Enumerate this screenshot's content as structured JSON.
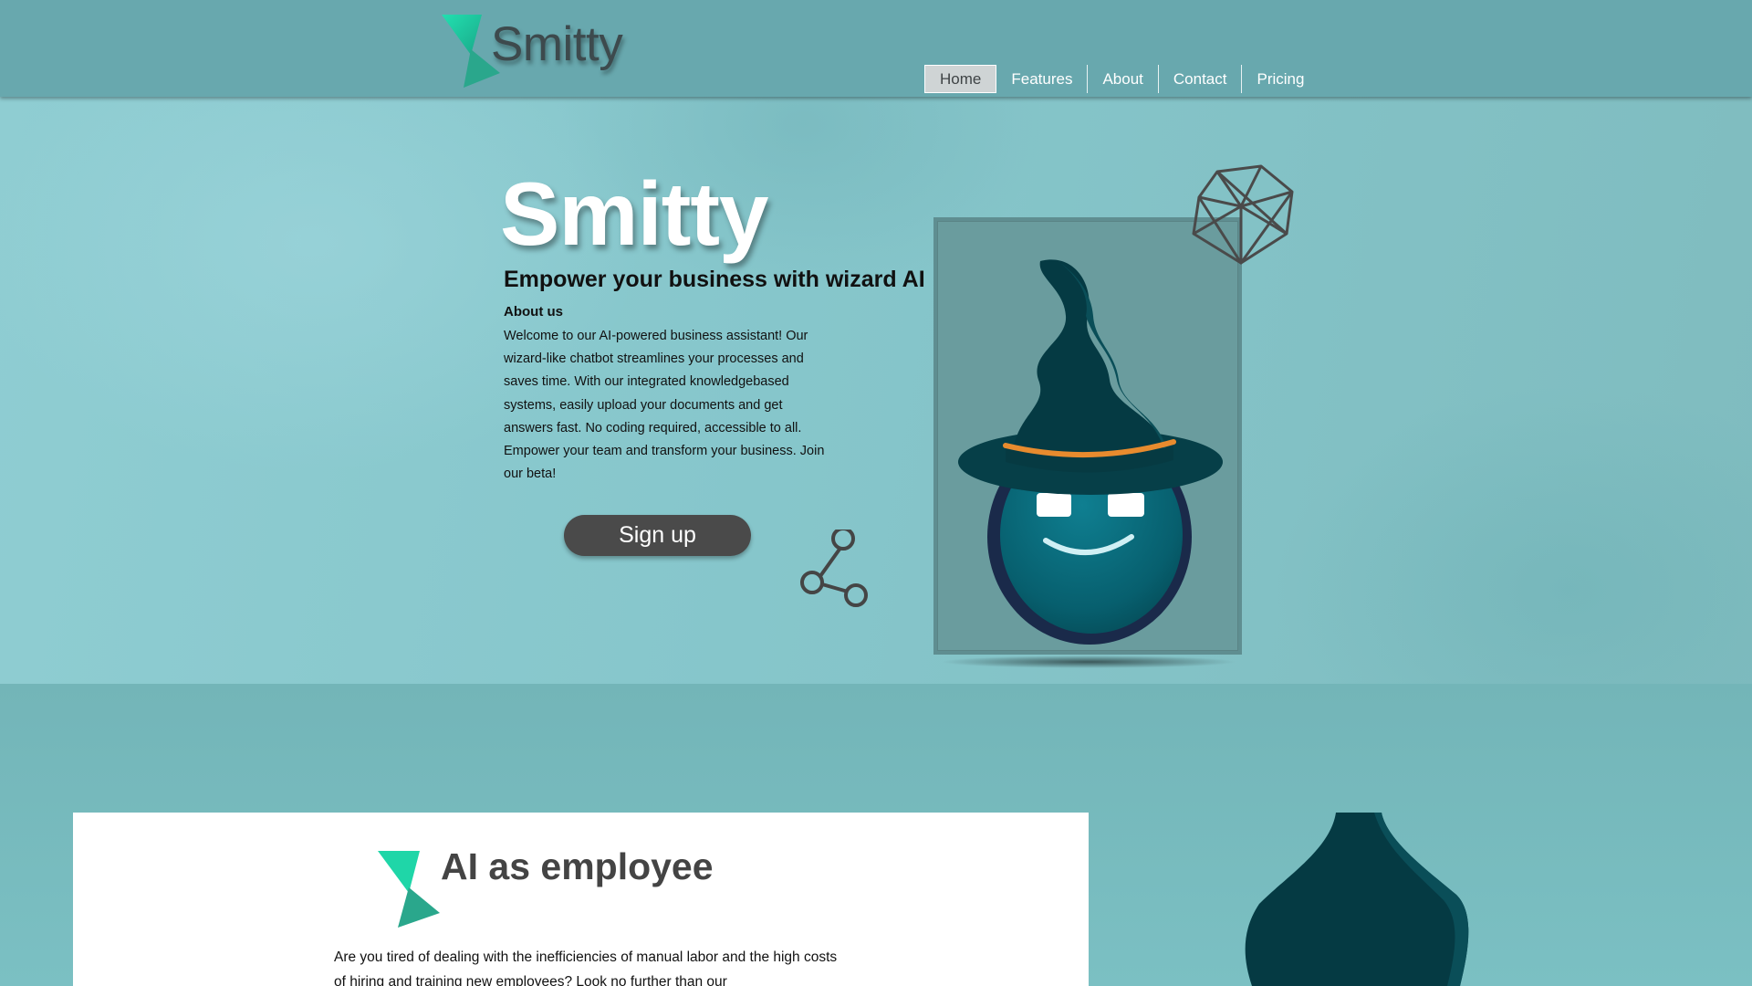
{
  "header": {
    "brand_name": "Smitty",
    "nav": [
      {
        "label": "Home",
        "active": true
      },
      {
        "label": "Features",
        "active": false
      },
      {
        "label": "About",
        "active": false
      },
      {
        "label": "Contact",
        "active": false
      },
      {
        "label": "Pricing",
        "active": false
      }
    ]
  },
  "hero": {
    "title": "Smitty",
    "tagline": "Empower your business with wizard AI",
    "about_heading": "About us",
    "about_text": "Welcome to our AI-powered business assistant! Our wizard-like chatbot streamlines your processes and saves time. With our integrated knowledgebased systems, easily upload your documents and get answers fast. No coding required, accessible to all. Empower your team and transform your business. Join our beta!",
    "signup_label": "Sign up"
  },
  "section": {
    "title": "AI as employee",
    "text": "Are you tired of dealing with the inefficiencies of manual labor and the high costs of hiring and training new employees? Look no further than our"
  },
  "colors": {
    "header_bg": "#68a8ae",
    "brand_teal": "#1fc9a0",
    "hat_dark": "#053f48",
    "signup_bg": "#4a4a4a",
    "hat_band": "#e88b2e"
  },
  "icons": [
    "logo-icon",
    "share-icon",
    "crystal-icon",
    "wizard-illustration"
  ]
}
